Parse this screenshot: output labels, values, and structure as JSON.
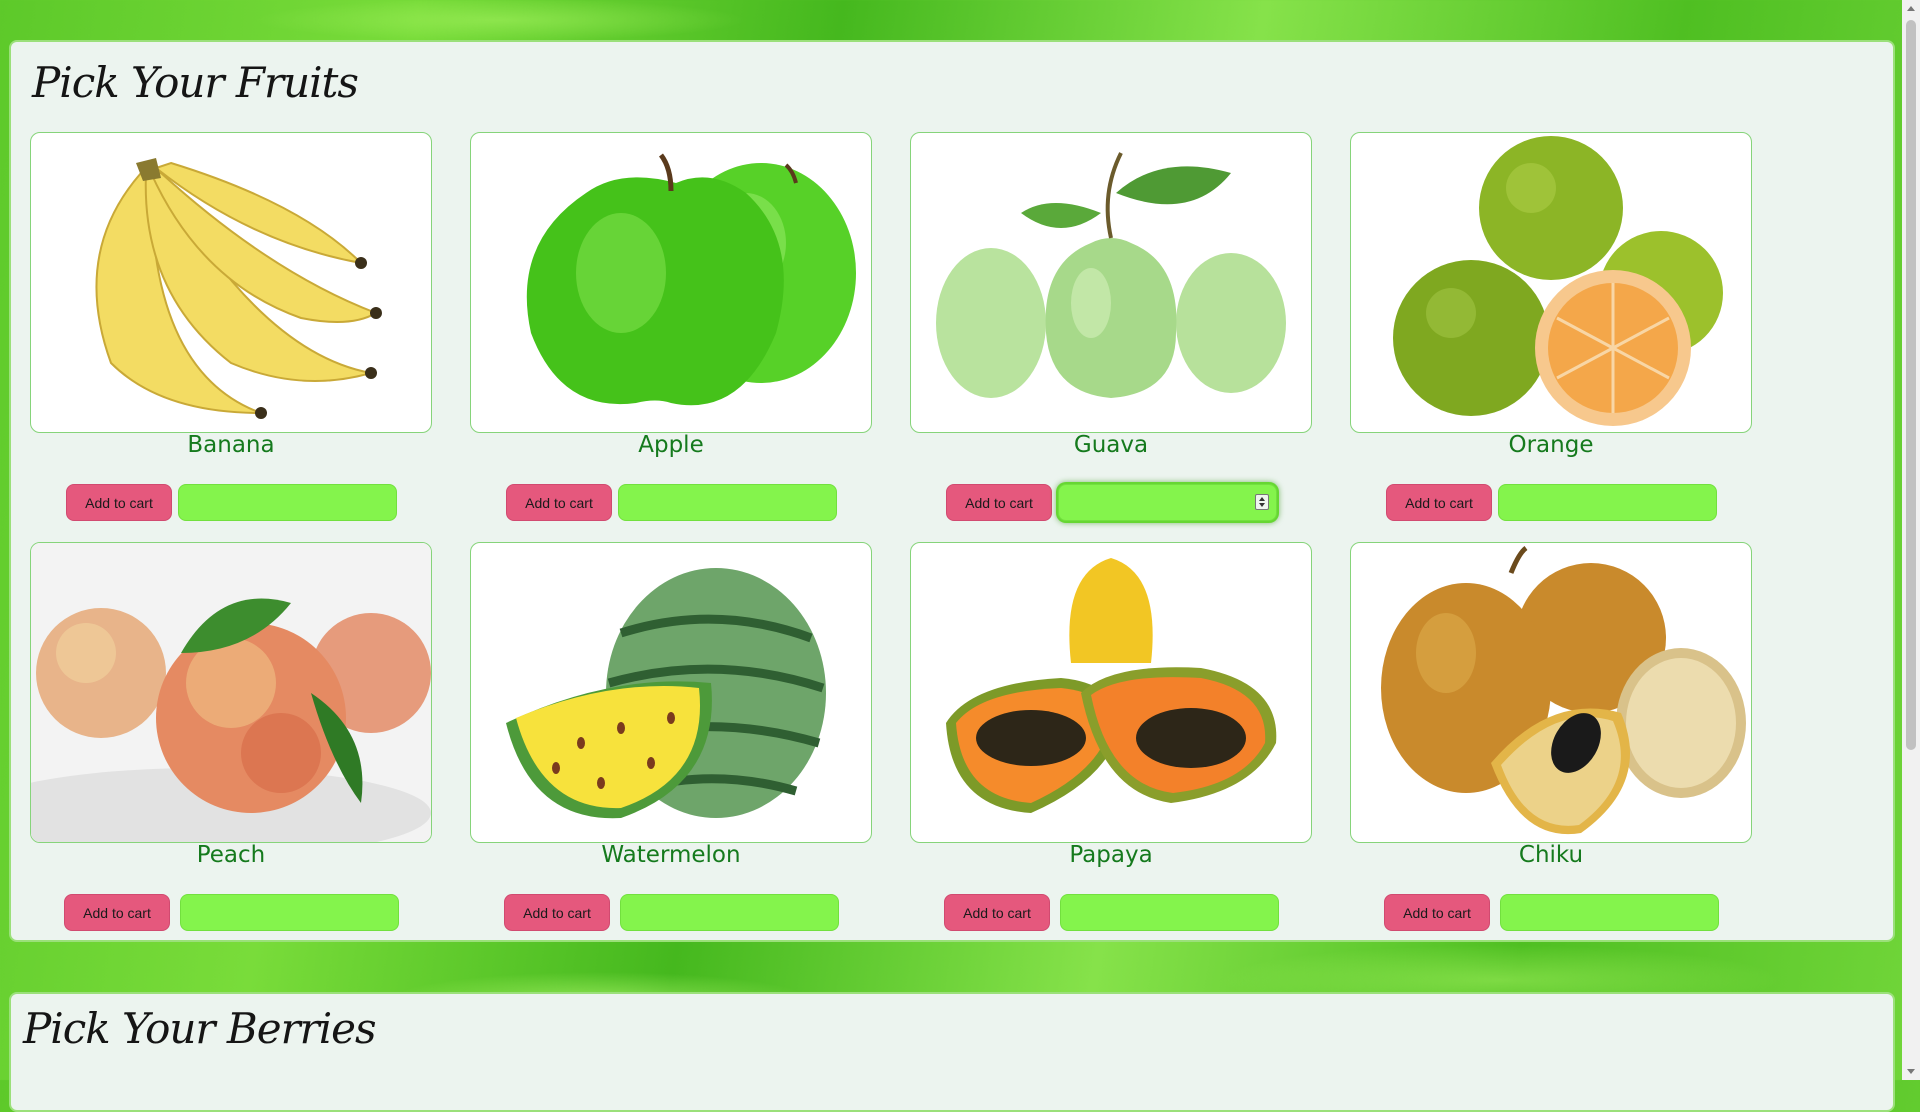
{
  "sections": [
    {
      "title": "Pick Your Fruits",
      "items": [
        {
          "name": "Banana",
          "add_label": "Add to cart",
          "quantity": ""
        },
        {
          "name": "Apple",
          "add_label": "Add to cart",
          "quantity": ""
        },
        {
          "name": "Guava",
          "add_label": "Add to cart",
          "quantity": ""
        },
        {
          "name": "Orange",
          "add_label": "Add to cart",
          "quantity": ""
        },
        {
          "name": "Peach",
          "add_label": "Add to cart",
          "quantity": ""
        },
        {
          "name": "Watermelon",
          "add_label": "Add to cart",
          "quantity": ""
        },
        {
          "name": "Papaya",
          "add_label": "Add to cart",
          "quantity": ""
        },
        {
          "name": "Chiku",
          "add_label": "Add to cart",
          "quantity": ""
        }
      ]
    },
    {
      "title": "Pick Your Berries"
    }
  ],
  "colors": {
    "button": "#e5587d",
    "quantity_field": "#84f44c",
    "product_name": "#157a1d",
    "panel": "#ecf4ef"
  },
  "icons": {
    "spinner": "number-spinner-icon",
    "images": [
      "banana-image",
      "apple-image",
      "guava-image",
      "orange-image",
      "peach-image",
      "watermelon-image",
      "papaya-image",
      "chiku-image"
    ]
  }
}
